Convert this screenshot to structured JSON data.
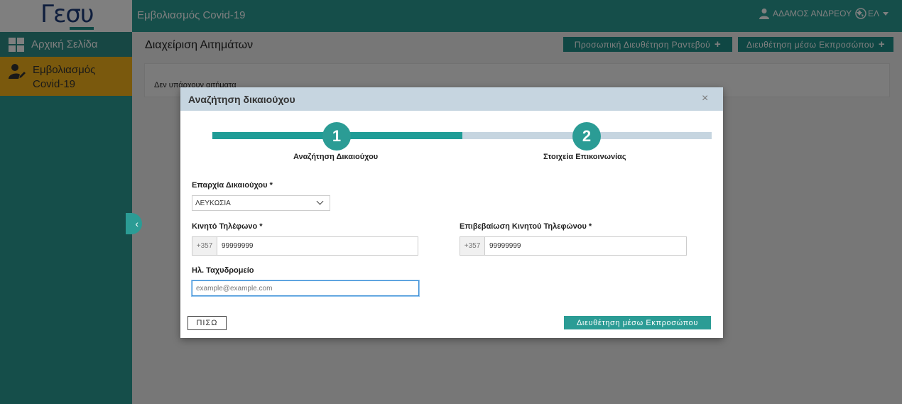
{
  "header": {
    "logo_text": "Γεσυ",
    "app_title": "Εμβολιασμός Covid-19",
    "user_name": "ΑΔΑΜΟΣ ΑΝΔΡΕΟΥ",
    "language": "ΕΛ"
  },
  "sidebar": {
    "items": [
      {
        "label": "Αρχική Σελίδα",
        "icon": "grid-icon"
      },
      {
        "label": "Εμβολιασμός Covid-19",
        "icon": "user-edit-icon",
        "active": true
      }
    ]
  },
  "main": {
    "title": "Διαχείριση Αιτημάτων",
    "actions": [
      {
        "label": "Προσωπική Διευθέτηση Ραντεβού",
        "icon": "+"
      },
      {
        "label": "Διευθέτηση μέσω Εκπροσώπου",
        "icon": "+"
      }
    ],
    "empty_message": "Δεν υπάρχουν αιτήματα"
  },
  "modal": {
    "title": "Αναζήτηση δικαιούχου",
    "close_icon": "×",
    "steps": [
      {
        "number": "1",
        "label": "Αναζήτηση Δικαιούχου",
        "completed": true
      },
      {
        "number": "2",
        "label": "Στοιχεία Επικοινωνίας",
        "completed": false
      }
    ],
    "fields": {
      "district": {
        "label": "Επαρχία Δικαιούχου *",
        "value": "ΛΕΥΚΩΣΙΑ"
      },
      "mobile": {
        "label": "Κινητό Τηλέφωνο *",
        "prefix": "+357",
        "value": "99999999"
      },
      "mobile_confirm": {
        "label": "Επιβεβαίωση Κινητού Τηλεφώνου *",
        "prefix": "+357",
        "value": "99999999"
      },
      "email": {
        "label": "Ηλ. Ταχυδρομείο",
        "placeholder": "example@example.com",
        "value": ""
      }
    },
    "buttons": {
      "back": "ΠΙΣΩ",
      "submit": "Διευθέτηση μέσω Εκπροσώπου"
    }
  },
  "colors": {
    "primary": "#2b9c95",
    "active_sidebar": "#f5b31a",
    "modal_header": "#c6d5e0",
    "logo": "#1f3d7a"
  }
}
